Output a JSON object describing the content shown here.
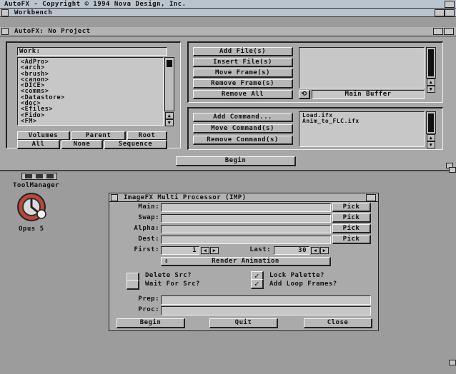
{
  "screen": {
    "title": "AutoFX - Copyright © 1994 Nova Design, Inc.",
    "workbench_label": "Workbench"
  },
  "autofx": {
    "title": "AutoFX: No Project",
    "files_path": "Work:",
    "file_list": [
      "<AdPro>",
      "<arch>",
      "<brush>",
      "<canon>",
      "<DICE>",
      "<comms>",
      "<Datastore>",
      "<doc>",
      "<Efiles>",
      "<Fido>",
      "<FM>"
    ],
    "volumes": "Volumes",
    "parent": "Parent",
    "root": "Root",
    "all": "All",
    "none": "None",
    "sequence": "Sequence",
    "add_files": "Add File(s)",
    "insert_files": "Insert File(s)",
    "move_frames": "Move Frame(s)",
    "remove_frames": "Remove Frame(s)",
    "remove_all": "Remove All",
    "main_buffer": "Main Buffer",
    "add_command": "Add Command...",
    "move_commands": "Move Command(s)",
    "remove_commands": "Remove Command(s)",
    "command_list": [
      "Load.ifx",
      "Anim_to_FLC.ifx"
    ],
    "begin": "Begin"
  },
  "toolmanager": {
    "label": "ToolManager",
    "dock_icons": [
      "tool-icon",
      "tool-icon",
      "tool-icon"
    ],
    "opus_label": "Opus 5"
  },
  "imp": {
    "title": "ImageFX Multi Processor (IMP)",
    "main_label": "Main:",
    "swap_label": "Swap:",
    "alpha_label": "Alpha:",
    "dest_label": "Dest:",
    "pick": "Pick",
    "first_label": "First:",
    "first_value": "1",
    "last_label": "Last:",
    "last_value": "30",
    "render_mode": "Render Animation",
    "delete_src": "Delete Src?",
    "wait_for_src": "Wait For Src?",
    "lock_palette": "Lock Palette?",
    "add_loop_frames": "Add Loop Frames?",
    "prep_label": "Prep:",
    "proc_label": "Proc:",
    "begin": "Begin",
    "quit": "Quit",
    "close": "Close"
  }
}
